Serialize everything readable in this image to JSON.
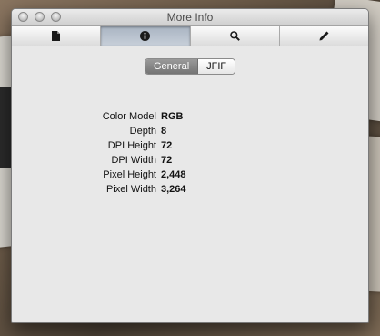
{
  "window": {
    "title": "More Info"
  },
  "toolbar": {
    "buttons": [
      {
        "icon": "document-icon",
        "active": false
      },
      {
        "icon": "info-icon",
        "active": true
      },
      {
        "icon": "magnifier-icon",
        "active": false
      },
      {
        "icon": "pen-icon",
        "active": false
      }
    ]
  },
  "tabs": {
    "general": "General",
    "jfif": "JFIF",
    "selected": "General"
  },
  "properties": [
    {
      "label": "Color Model",
      "value": "RGB"
    },
    {
      "label": "Depth",
      "value": "8"
    },
    {
      "label": "DPI Height",
      "value": "72"
    },
    {
      "label": "DPI Width",
      "value": "72"
    },
    {
      "label": "Pixel Height",
      "value": "2,448"
    },
    {
      "label": "Pixel Width",
      "value": "3,264"
    }
  ],
  "colors": {
    "window_bg": "#e8e8e8",
    "selected_tab": "#828282",
    "active_toolbar": "#b8c1cd"
  }
}
